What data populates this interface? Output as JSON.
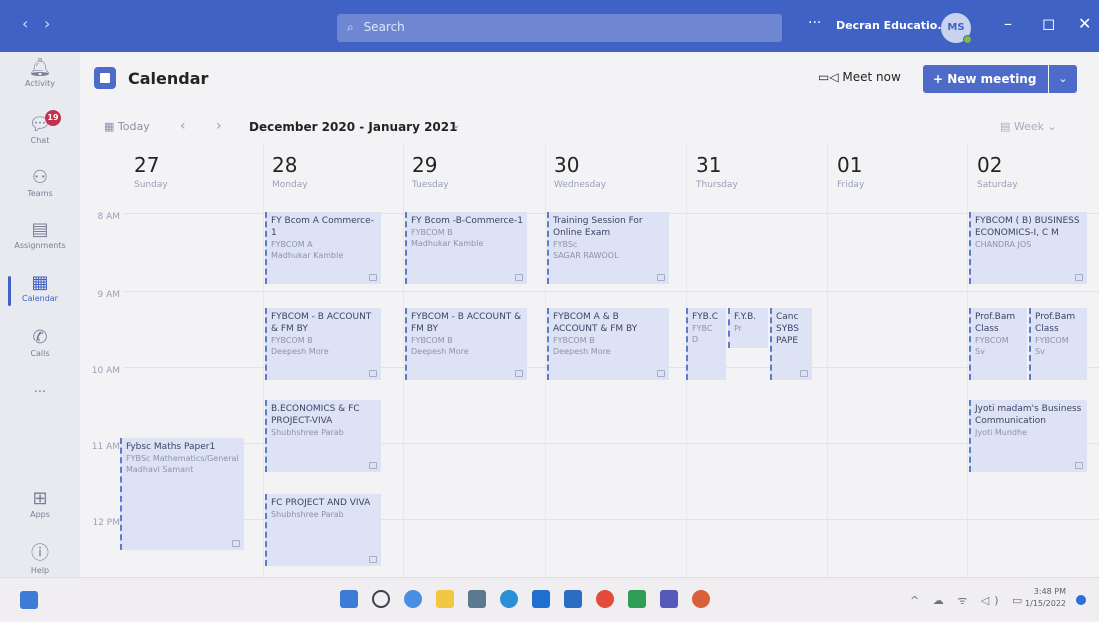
{
  "titlebar": {
    "search_placeholder": "Search",
    "org_name": "Decran Educatio...",
    "avatar_initials": "MS",
    "more_label": "···",
    "minimize": "–",
    "maximize": "◻",
    "close": "✕"
  },
  "rail": [
    {
      "label": "Activity",
      "icon": "bell-icon"
    },
    {
      "label": "Chat",
      "icon": "chat-icon",
      "badge": "19"
    },
    {
      "label": "Teams",
      "icon": "teams-icon"
    },
    {
      "label": "Assignments",
      "icon": "assignments-icon"
    },
    {
      "label": "Calendar",
      "icon": "calendar-icon",
      "active": true
    },
    {
      "label": "Calls",
      "icon": "phone-icon"
    },
    {
      "label": "···",
      "icon": "more-icon"
    },
    {
      "label": "Apps",
      "icon": "apps-icon"
    },
    {
      "label": "Help",
      "icon": "help-icon"
    }
  ],
  "header": {
    "title": "Calendar",
    "meet_now": "Meet now",
    "new_meeting": "+ New meeting",
    "today": "Today",
    "range": "December 2020 - January 2021",
    "view": "Week"
  },
  "days": [
    {
      "num": "27",
      "name": "Sunday"
    },
    {
      "num": "28",
      "name": "Monday"
    },
    {
      "num": "29",
      "name": "Tuesday"
    },
    {
      "num": "30",
      "name": "Wednesday"
    },
    {
      "num": "31",
      "name": "Thursday"
    },
    {
      "num": "01",
      "name": "Friday"
    },
    {
      "num": "02",
      "name": "Saturday"
    }
  ],
  "times": [
    "8 AM",
    "9 AM",
    "10 AM",
    "11 AM",
    "12 PM"
  ],
  "events": [
    {
      "title": "FY Bcom A Commerce-1",
      "sub1": "FYBCOM A",
      "sub2": "Madhukar Kamble"
    },
    {
      "title": "FY Bcom -B-Commerce-1",
      "sub1": "FYBCOM B",
      "sub2": "Madhukar Kamble"
    },
    {
      "title": "Training Session For Online Exam",
      "sub1": "FYBSc",
      "sub2": "SAGAR RAWOOL"
    },
    {
      "title": "FYBCOM ( B) BUSINESS ECONOMICS-I, C M",
      "sub1": "CHANDRA JOS",
      "sub2": ""
    },
    {
      "title": "FYBCOM - B ACCOUNT & FM BY",
      "sub1": "FYBCOM B",
      "sub2": "Deepesh More"
    },
    {
      "title": "FYBCOM - B ACCOUNT & FM BY",
      "sub1": "FYBCOM B",
      "sub2": "Deepesh More"
    },
    {
      "title": "FYBCOM A & B ACCOUNT & FM BY",
      "sub1": "FYBCOM B",
      "sub2": "Deepesh More"
    },
    {
      "title": "FYB.C",
      "sub1": "FYBC",
      "sub2": "D"
    },
    {
      "title": "F.Y.B.",
      "sub1": "Pr",
      "sub2": ""
    },
    {
      "title": "Canc SYBS PAPE",
      "sub1": "",
      "sub2": ""
    },
    {
      "title": "Prof.Bam Class",
      "sub1": "FYBCOM",
      "sub2": "Sv"
    },
    {
      "title": "Prof.Bam Class",
      "sub1": "FYBCOM",
      "sub2": "Sv"
    },
    {
      "title": "B.ECONOMICS & FC PROJECT-VIVA",
      "sub1": "Shubhshree Parab",
      "sub2": ""
    },
    {
      "title": "Jyoti madam's Business Communication",
      "sub1": "Jyoti Mundhe",
      "sub2": ""
    },
    {
      "title": "Fybsc Maths Paper1",
      "sub1": "FYBSc Mathematics/General",
      "sub2": "Madhavi Samant"
    },
    {
      "title": "FC PROJECT AND VIVA",
      "sub1": "Shubhshree Parab",
      "sub2": ""
    }
  ],
  "taskbar": {
    "clock_time": "3:48 PM",
    "clock_date": "1/15/2022",
    "tray": "^ ☁ ᯤ ◁) ▭"
  },
  "colors": {
    "titlebar": "#3f62c4",
    "accent": "#4f6bc9",
    "event_bg": "#dde3f4",
    "badge": "#c4314b"
  }
}
